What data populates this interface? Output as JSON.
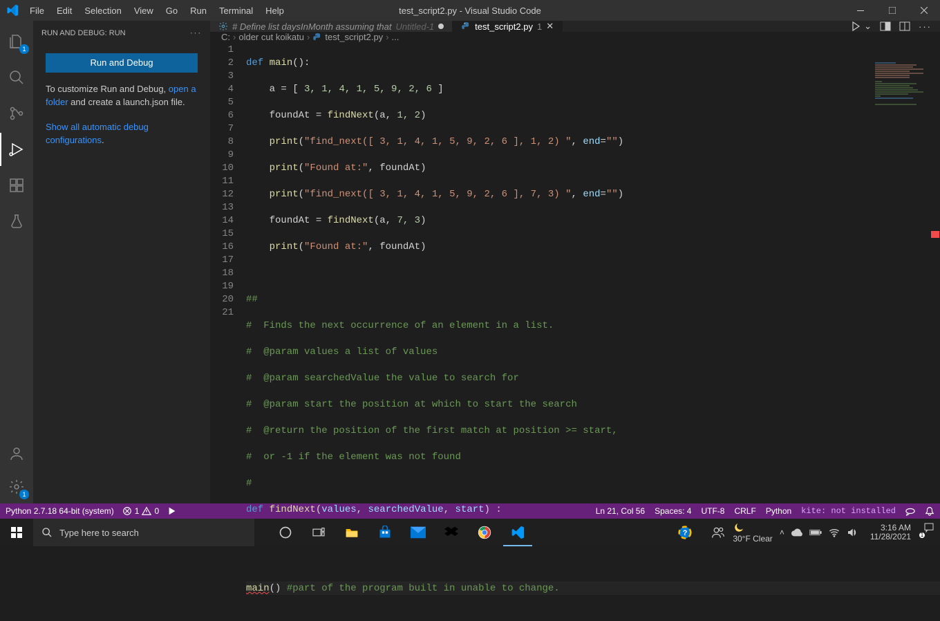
{
  "titlebar": {
    "title": "test_script2.py - Visual Studio Code",
    "menu": [
      "File",
      "Edit",
      "Selection",
      "View",
      "Go",
      "Run",
      "Terminal",
      "Help"
    ]
  },
  "sidebar": {
    "header": "RUN AND DEBUG: RUN",
    "run_button": "Run and Debug",
    "customize_pre": "To customize Run and Debug, ",
    "customize_link": "open a folder",
    "customize_post": " and create a launch.json file.",
    "show_link": "Show all automatic debug configurations",
    "show_post": "."
  },
  "tabs": [
    {
      "icon": "gear",
      "label": "# Define list daysInMonth assuming that",
      "suffix": "Untitled-1",
      "dirty": true,
      "active": false
    },
    {
      "icon": "py",
      "label": "test_script2.py",
      "suffix": "1",
      "dirty": false,
      "active": true
    }
  ],
  "breadcrumb": [
    "C:",
    "older cut koikatu",
    "test_script2.py",
    "..."
  ],
  "code_lines": 21,
  "code": {
    "l1": {
      "kw": "def",
      "fn": "main",
      "rest": "():"
    },
    "l2_a": "a = [ ",
    "l2_nums": "3, 1, 4, 1, 5, 9, 2, 6",
    "l2_b": " ]",
    "l3_a": "foundAt = ",
    "l3_fn": "findNext",
    "l3_b": "(a, ",
    "l3_n": "1, 2",
    "l3_c": ")",
    "l4_fn": "print",
    "l4_s": "\"find_next([ 3, 1, 4, 1, 5, 9, 2, 6 ], 1, 2) \"",
    "l4_mid": ", ",
    "l4_kw": "end",
    "l4_eq": "=",
    "l4_s2": "\"\"",
    "l5_fn": "print",
    "l5_s": "\"Found at:\"",
    "l5_b": ", foundAt)",
    "l6_fn": "print",
    "l6_s": "\"find_next([ 3, 1, 4, 1, 5, 9, 2, 6 ], 7, 3) \"",
    "l6_mid": ", ",
    "l6_kw": "end",
    "l6_eq": "=",
    "l6_s2": "\"\"",
    "l7_a": "foundAt = ",
    "l7_fn": "findNext",
    "l7_b": "(a, ",
    "l7_n": "7, 3",
    "l7_c": ")",
    "l8_fn": "print",
    "l8_s": "\"Found at:\"",
    "l8_b": ", foundAt)",
    "l10": "##",
    "l11": "#  Finds the next occurrence of an element in a list.",
    "l12": "#  @param values a list of values",
    "l13": "#  @param searchedValue the value to search for",
    "l14": "#  @param start the position at which to start the search",
    "l15": "#  @return the position of the first match at position >= start,",
    "l16": "#  or -1 if the element was not found",
    "l17": "#",
    "l18_kw": "def",
    "l18_fn": "findNext",
    "l18_a": "(",
    "l18_p1": "values",
    "l18_c1": ", ",
    "l18_p2": "searchedValue",
    "l18_c2": ", ",
    "l18_p3": "start",
    "l18_b": ") :",
    "l21_fn": "main",
    "l21_a": "()",
    "l21_cm": " #part of the program built in unable to change."
  },
  "status": {
    "python": "Python 2.7.18 64-bit (system)",
    "errors": "1",
    "warnings": "0",
    "pos": "Ln 21, Col 56",
    "spaces": "Spaces: 4",
    "enc": "UTF-8",
    "eol": "CRLF",
    "lang": "Python",
    "kite": "kite: not installed"
  },
  "taskbar": {
    "search_placeholder": "Type here to search",
    "weather": "30°F  Clear",
    "time": "3:16 AM",
    "date": "11/28/2021"
  }
}
